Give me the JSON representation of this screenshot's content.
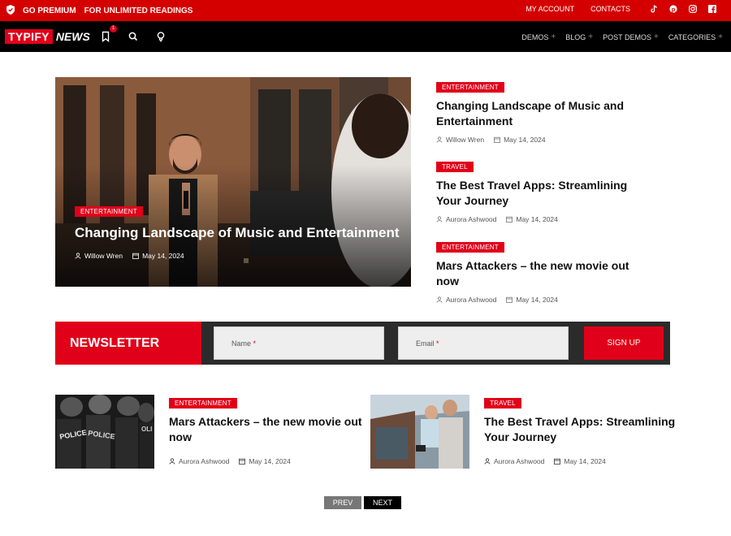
{
  "topbar": {
    "promo_bold": "GO PREMIUM",
    "promo_text": "FOR UNLIMITED READINGS",
    "links": [
      "MY ACCOUNT",
      "CONTACTS"
    ],
    "social_icons": [
      "tiktok-icon",
      "pinterest-icon",
      "instagram-icon",
      "facebook-icon"
    ],
    "bg_color": "#d40000"
  },
  "navbar": {
    "logo_box": "TYPIFY",
    "logo_text": "NEWS",
    "bookmark_count": "1",
    "menu": [
      "DEMOS",
      "BLOG",
      "POST DEMOS",
      "CATEGORIES"
    ]
  },
  "hero": {
    "tag": "ENTERTAINMENT",
    "title": "Changing Landscape of Music and Entertainment",
    "author": "Willow Wren",
    "date": "May 14, 2024"
  },
  "side_posts": [
    {
      "tag": "ENTERTAINMENT",
      "title": "Changing Landscape of Music and Entertainment",
      "author": "Willow Wren",
      "date": "May 14, 2024"
    },
    {
      "tag": "TRAVEL",
      "title": "The Best Travel Apps: Streamlining Your Journey",
      "author": "Aurora Ashwood",
      "date": "May 14, 2024"
    },
    {
      "tag": "ENTERTAINMENT",
      "title": "Mars Attackers – the new movie out now",
      "author": "Aurora Ashwood",
      "date": "May 14, 2024"
    }
  ],
  "newsletter": {
    "label": "NEWSLETTER",
    "name_placeholder": "Name",
    "email_placeholder": "Email",
    "required_mark": "*",
    "button": "SIGN UP"
  },
  "cards": [
    {
      "tag": "ENTERTAINMENT",
      "title": "Mars Attackers – the new movie out now",
      "author": "Aurora Ashwood",
      "date": "May 14, 2024"
    },
    {
      "tag": "TRAVEL",
      "title": "The Best Travel Apps: Streamlining Your Journey",
      "author": "Aurora Ashwood",
      "date": "May 14, 2024"
    }
  ],
  "pagination": {
    "prev": "PREV",
    "next": "NEXT"
  },
  "colors": {
    "accent": "#e10019",
    "dark": "#000000",
    "newsletter_bg": "#2b2b2b"
  }
}
